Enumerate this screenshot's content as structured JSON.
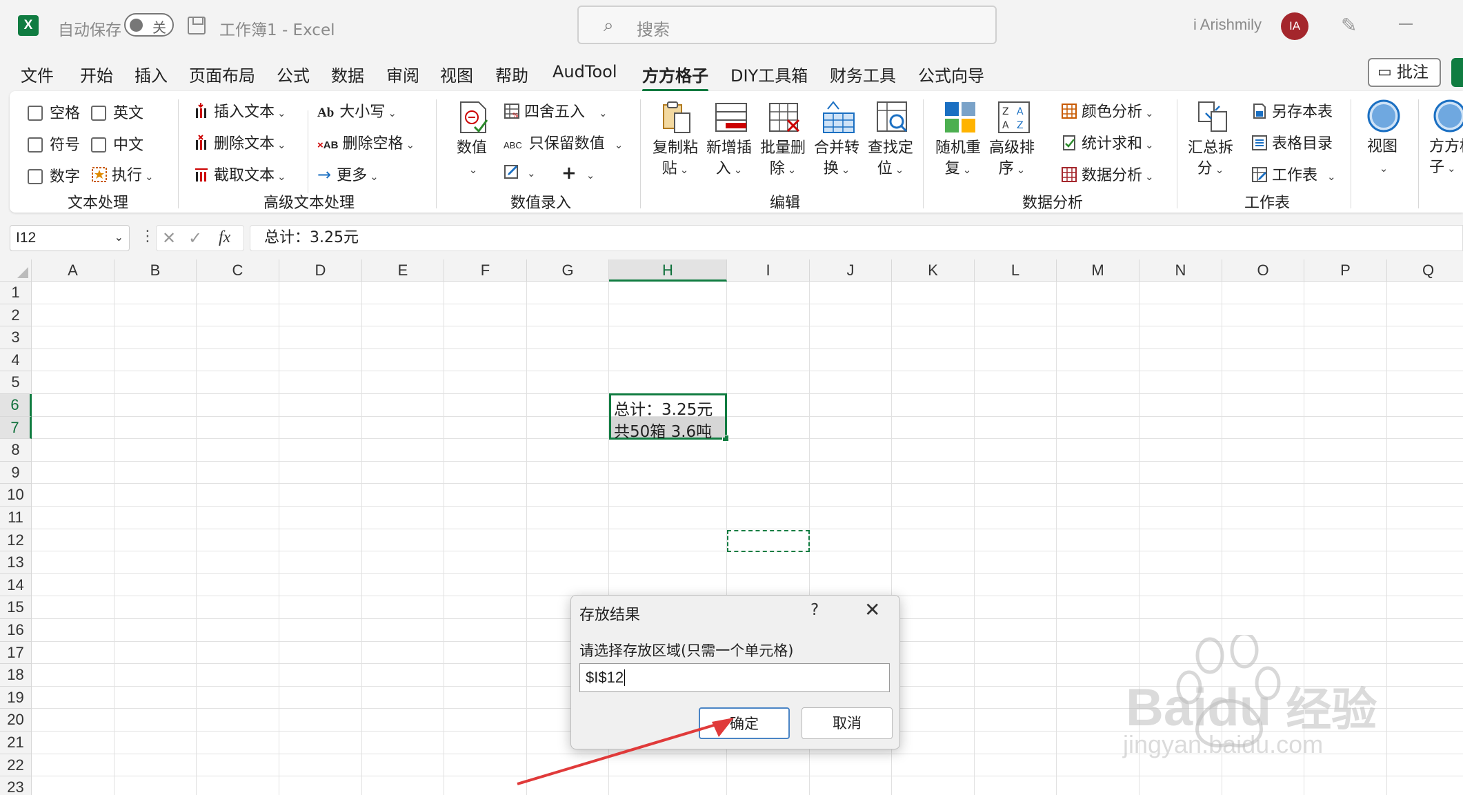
{
  "titlebar": {
    "autosave_label": "自动保存",
    "autosave_state": "关",
    "doc_title": "工作簿1  -  Excel",
    "search_placeholder": "搜索",
    "user_name": "i Arishmily",
    "avatar_initials": "IA"
  },
  "menu": {
    "items": [
      "文件",
      "开始",
      "插入",
      "页面布局",
      "公式",
      "数据",
      "审阅",
      "视图",
      "帮助",
      "AudTool",
      "方方格子",
      "DIY工具箱",
      "财务工具",
      "公式向导"
    ],
    "active": "方方格子",
    "comment_button": "批注"
  },
  "ribbon": {
    "text_group": {
      "label": "文本处理",
      "checks": [
        "空格",
        "英文",
        "符号",
        "中文",
        "数字"
      ],
      "execute": "执行"
    },
    "adv_text_group": {
      "label": "高级文本处理",
      "insert_text": "插入文本",
      "delete_text": "删除文本",
      "extract_text": "截取文本",
      "case": "大小写",
      "delete_space": "删除空格",
      "more": "更多"
    },
    "number_group": {
      "label": "数值录入",
      "number": "数值",
      "round": "四舍五入",
      "keep_number": "只保留数值"
    },
    "edit_group": {
      "label": "编辑",
      "copy_paste": [
        "复制粘",
        "贴"
      ],
      "new_insert": [
        "新增插",
        "入"
      ],
      "batch_delete": [
        "批量删",
        "除"
      ],
      "merge_convert": [
        "合并转",
        "换"
      ],
      "find_locate": [
        "查找定",
        "位"
      ]
    },
    "data_group": {
      "label": "数据分析",
      "random_repeat": [
        "随机重",
        "复"
      ],
      "advanced_sort": [
        "高级排",
        "序"
      ],
      "color_analysis": "颜色分析",
      "stat_sum": "统计求和",
      "data_analysis": "数据分析"
    },
    "sheet_group": {
      "label": "工作表",
      "summary_split": [
        "汇总拆",
        "分"
      ],
      "save_sheet": "另存本表",
      "sheet_index": "表格目录",
      "worksheet": "工作表"
    },
    "view": "视图",
    "fangfang": [
      "方方格",
      "子"
    ]
  },
  "formula_bar": {
    "name_box": "I12",
    "formula": "总计：3.25元"
  },
  "grid": {
    "columns": [
      "A",
      "B",
      "C",
      "D",
      "E",
      "F",
      "G",
      "H",
      "I",
      "J",
      "K",
      "L",
      "M",
      "N",
      "O",
      "P",
      "Q"
    ],
    "rows": [
      "1",
      "2",
      "3",
      "4",
      "5",
      "6",
      "7",
      "8",
      "9",
      "10",
      "11",
      "12",
      "13",
      "14",
      "15",
      "16",
      "17",
      "18",
      "19",
      "20",
      "21",
      "22",
      "23"
    ],
    "h6": "总计：3.25元",
    "h7": "共50箱 3.6吨"
  },
  "dialog": {
    "title": "存放结果",
    "help": "?",
    "prompt": "请选择存放区域(只需一个单元格)",
    "value": "$I$12",
    "ok": "确定",
    "cancel": "取消"
  },
  "watermark": {
    "brand": "Bai",
    "brand2": "du",
    "brand3": "经验",
    "url": "jingyan.baidu.com"
  },
  "colors": {
    "excel_green": "#107c41",
    "avatar_red": "#a4262c",
    "arrow_red": "#e03a3a"
  }
}
